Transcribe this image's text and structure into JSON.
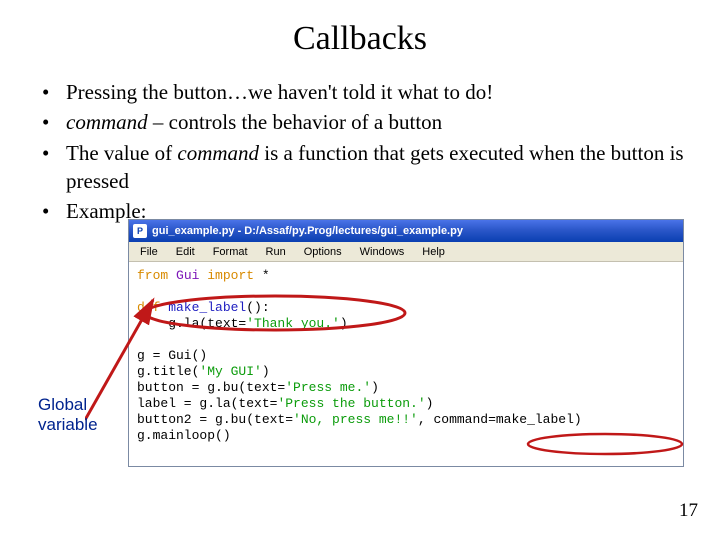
{
  "title": "Callbacks",
  "bullets": {
    "b1": "Pressing the button…we haven't told it what to do!",
    "b2_pre": "command",
    "b2_post": " – controls the behavior of a button",
    "b3_pre": "The value of ",
    "b3_em": "command",
    "b3_post": " is a function that gets executed when the button is pressed",
    "b4": "Example:"
  },
  "editor": {
    "window_title": "gui_example.py - D:/Assaf/py.Prog/lectures/gui_example.py",
    "menus": [
      "File",
      "Edit",
      "Format",
      "Run",
      "Options",
      "Windows",
      "Help"
    ]
  },
  "code": {
    "l1_kw": "from",
    "l1_mod": " Gui ",
    "l1_kw2": "import",
    "l1_star": " *",
    "l3_kw": "def",
    "l3_fn": " make_label",
    "l3_p": "():",
    "l4_body": "    g.la(text=",
    "l4_str": "'Thank you.'",
    "l4_end": ")",
    "l6": "g = Gui()",
    "l7_a": "g.title(",
    "l7_str": "'My GUI'",
    "l7_b": ")",
    "l8_a": "button = g.bu(text=",
    "l8_str": "'Press me.'",
    "l8_b": ")",
    "l9_a": "label = g.la(text=",
    "l9_str": "'Press the button.'",
    "l9_b": ")",
    "l10_a": "button2 = g.bu(text=",
    "l10_str": "'No, press me!!'",
    "l10_b": ", command=make_label)",
    "l11": "g.mainloop()"
  },
  "annotation": {
    "line1": "Global",
    "line2": "variable"
  },
  "page_number": "17"
}
